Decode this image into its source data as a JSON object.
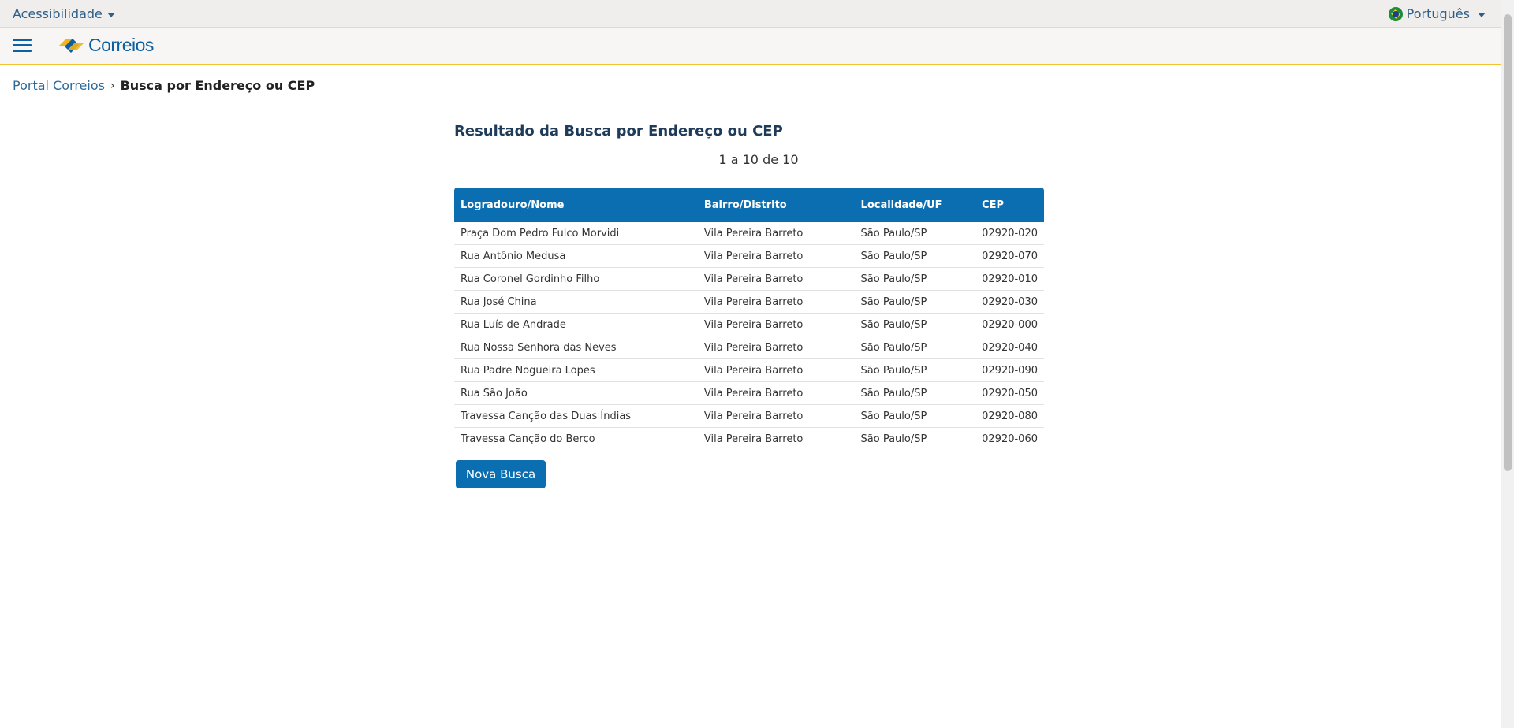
{
  "topbar": {
    "accessibility_label": "Acessibilidade",
    "language_label": "Português"
  },
  "header": {
    "logo_text": "Correios"
  },
  "breadcrumb": {
    "home": "Portal Correios",
    "separator": "›",
    "current": "Busca por Endereço ou CEP"
  },
  "main": {
    "title": "Resultado da Busca por Endereço ou CEP",
    "counter": "1 a 10 de 10",
    "button_label": "Nova Busca"
  },
  "table": {
    "columns": [
      "Logradouro/Nome",
      "Bairro/Distrito",
      "Localidade/UF",
      "CEP"
    ],
    "rows": [
      [
        "Praça Dom Pedro Fulco Morvidi",
        "Vila Pereira Barreto",
        "São Paulo/SP",
        "02920-020"
      ],
      [
        "Rua Antônio Medusa",
        "Vila Pereira Barreto",
        "São Paulo/SP",
        "02920-070"
      ],
      [
        "Rua Coronel Gordinho Filho",
        "Vila Pereira Barreto",
        "São Paulo/SP",
        "02920-010"
      ],
      [
        "Rua José China",
        "Vila Pereira Barreto",
        "São Paulo/SP",
        "02920-030"
      ],
      [
        "Rua Luís de Andrade",
        "Vila Pereira Barreto",
        "São Paulo/SP",
        "02920-000"
      ],
      [
        "Rua Nossa Senhora das Neves",
        "Vila Pereira Barreto",
        "São Paulo/SP",
        "02920-040"
      ],
      [
        "Rua Padre Nogueira Lopes",
        "Vila Pereira Barreto",
        "São Paulo/SP",
        "02920-090"
      ],
      [
        "Rua São João",
        "Vila Pereira Barreto",
        "São Paulo/SP",
        "02920-050"
      ],
      [
        "Travessa Canção das Duas Índias",
        "Vila Pereira Barreto",
        "São Paulo/SP",
        "02920-080"
      ],
      [
        "Travessa Canção do Berço",
        "Vila Pereira Barreto",
        "São Paulo/SP",
        "02920-060"
      ]
    ]
  },
  "colors": {
    "primary": "#0b6eb0",
    "link": "#2d6a99",
    "accent_line": "#f2c230",
    "logo_yellow": "#f2b417"
  },
  "icons": {
    "menu": "hamburger-icon",
    "language_flag": "brazil-flag-icon",
    "dropdown": "chevron-down-icon"
  }
}
